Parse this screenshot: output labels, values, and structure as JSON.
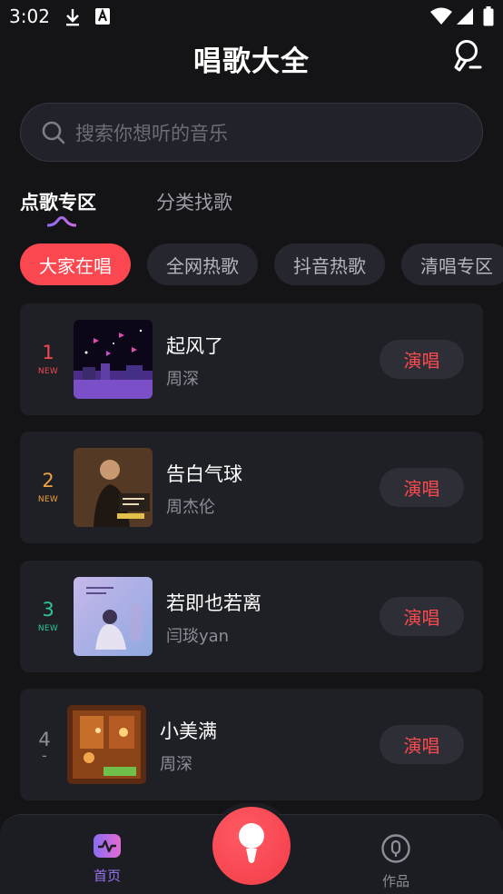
{
  "status_bar": {
    "time": "3:02"
  },
  "header": {
    "title": "唱歌大全"
  },
  "search": {
    "placeholder": "搜索你想听的音乐"
  },
  "main_tabs": [
    {
      "label": "点歌专区",
      "active": true
    },
    {
      "label": "分类找歌",
      "active": false
    }
  ],
  "chips": [
    {
      "label": "大家在唱",
      "active": true
    },
    {
      "label": "全网热歌",
      "active": false
    },
    {
      "label": "抖音热歌",
      "active": false
    },
    {
      "label": "清唱专区",
      "active": false
    }
  ],
  "songs": [
    {
      "rank": "1",
      "tag": "NEW",
      "title": "起风了",
      "artist": "周深",
      "action": "演唱",
      "rank_color": "#f0484e"
    },
    {
      "rank": "2",
      "tag": "NEW",
      "title": "告白气球",
      "artist": "周杰伦",
      "action": "演唱",
      "rank_color": "#f0a23c"
    },
    {
      "rank": "3",
      "tag": "NEW",
      "title": "若即也若离",
      "artist": "闫琰yan",
      "action": "演唱",
      "rank_color": "#2fc59a"
    },
    {
      "rank": "4",
      "tag": "-",
      "title": "小美满",
      "artist": "周深",
      "action": "演唱",
      "rank_color": "#8d8e97"
    }
  ],
  "bottom_nav": {
    "home_label": "首页",
    "works_label": "作品"
  },
  "colors": {
    "accent": "#fb4750",
    "background": "#141417",
    "card": "#1f2026",
    "nav_active": "#9a74f0"
  },
  "icons": [
    "download-icon",
    "a-badge-icon",
    "wifi-icon",
    "signal-icon",
    "battery-icon",
    "microphone-icon",
    "search-icon",
    "pulse-icon",
    "mic-record-icon",
    "works-icon"
  ]
}
